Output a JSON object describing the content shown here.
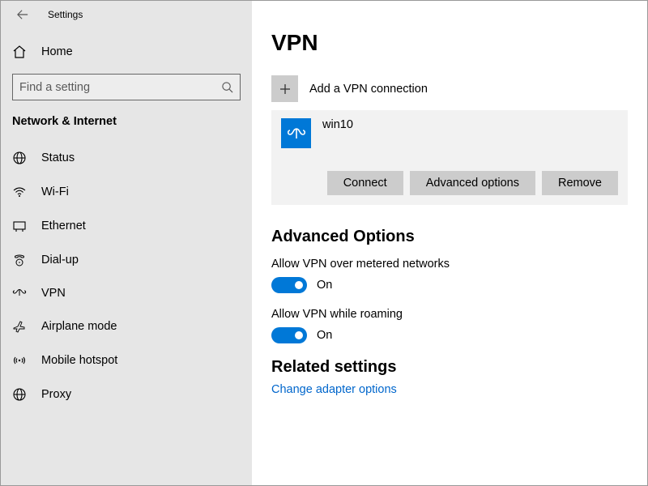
{
  "titlebar": {
    "title": "Settings"
  },
  "home": {
    "label": "Home"
  },
  "search": {
    "placeholder": "Find a setting"
  },
  "category": {
    "title": "Network & Internet"
  },
  "nav": [
    {
      "label": "Status"
    },
    {
      "label": "Wi-Fi"
    },
    {
      "label": "Ethernet"
    },
    {
      "label": "Dial-up"
    },
    {
      "label": "VPN"
    },
    {
      "label": "Airplane mode"
    },
    {
      "label": "Mobile hotspot"
    },
    {
      "label": "Proxy"
    }
  ],
  "page": {
    "title": "VPN"
  },
  "add_vpn": {
    "label": "Add a VPN connection"
  },
  "conn": {
    "name": "win10",
    "connect_btn": "Connect",
    "advanced_btn": "Advanced options",
    "remove_btn": "Remove"
  },
  "advanced": {
    "title": "Advanced Options",
    "metered_label": "Allow VPN over metered networks",
    "metered_state": "On",
    "roaming_label": "Allow VPN while roaming",
    "roaming_state": "On"
  },
  "related": {
    "title": "Related settings",
    "link1": "Change adapter options"
  }
}
